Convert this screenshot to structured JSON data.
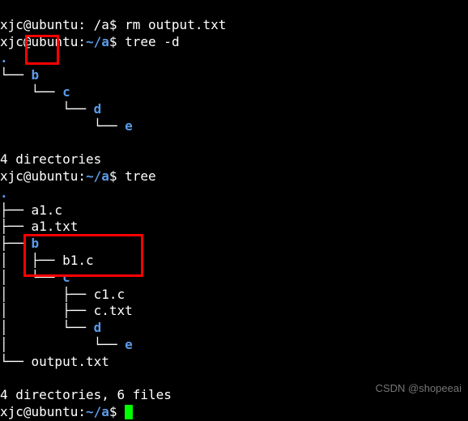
{
  "colors": {
    "dir": "#5a9be9",
    "fg": "#ffffff",
    "bg": "#000000",
    "highlight": "#ff0000",
    "cursor": "#00ff00"
  },
  "lines": {
    "truncated_top": "xjc@ubuntu: /a$ rm output.txt",
    "prompt1_user": "xjc@ubuntu:",
    "prompt1_path": "~/a",
    "prompt1_sym": "$ ",
    "cmd1": "tree -d",
    "dot1": ".",
    "b1": "b",
    "c1": "c",
    "d1": "d",
    "e1": "e",
    "summary1": "4 directories",
    "prompt2_user": "xjc@ubuntu:",
    "prompt2_path": "~/a",
    "prompt2_sym": "$ ",
    "cmd2": "tree",
    "dot2": ".",
    "a1c": "a1.c",
    "a1txt": "a1.txt",
    "b2": "b",
    "b1c": "b1.c",
    "c2": "c",
    "c1c": "c1.c",
    "ctxt": "c.txt",
    "d2": "d",
    "e2": "e",
    "outtxt": "output.txt",
    "summary2": "4 directories, 6 files",
    "prompt3_user": "xjc@ubuntu:",
    "prompt3_path": "~/a",
    "prompt3_sym": "$ "
  },
  "tree": {
    "branch": "├── ",
    "last": "└── ",
    "pipe": "│   ",
    "space": "    "
  },
  "watermark": "CSDN @shopeeai"
}
